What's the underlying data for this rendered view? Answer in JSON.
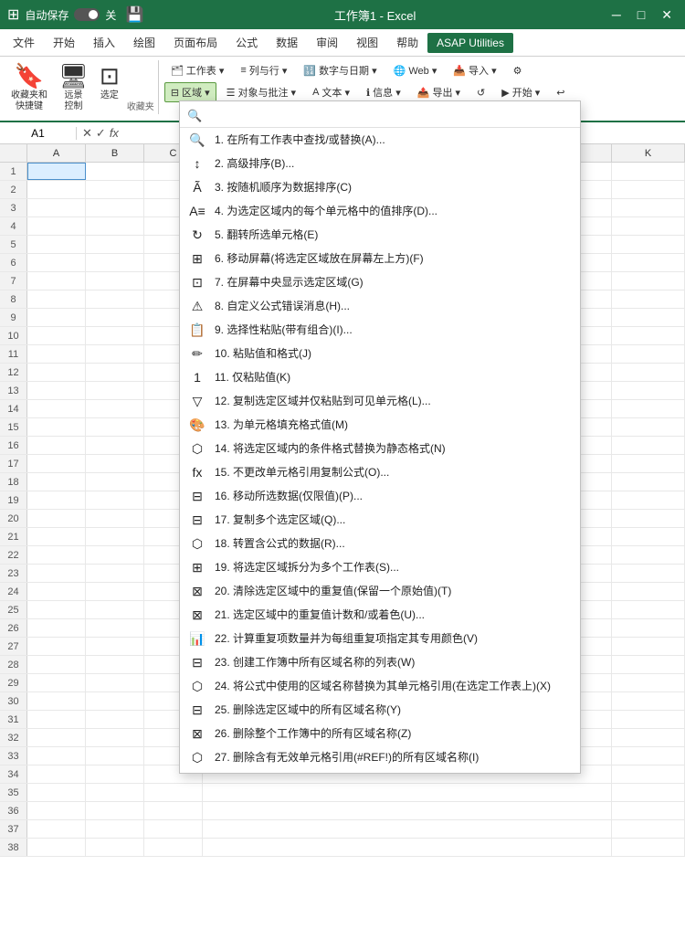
{
  "titleBar": {
    "appIcon": "⊞",
    "autosave_label": "自动保存",
    "toggle_state": "关",
    "save_icon": "💾",
    "filename": "工作簿1 - Excel",
    "min_btn": "─",
    "max_btn": "□",
    "close_btn": "✕"
  },
  "menuBar": {
    "items": [
      {
        "label": "文件",
        "id": "file"
      },
      {
        "label": "开始",
        "id": "home"
      },
      {
        "label": "插入",
        "id": "insert"
      },
      {
        "label": "绘图",
        "id": "draw"
      },
      {
        "label": "页面布局",
        "id": "pagelayout"
      },
      {
        "label": "公式",
        "id": "formulas"
      },
      {
        "label": "数据",
        "id": "data"
      },
      {
        "label": "审阅",
        "id": "review"
      },
      {
        "label": "视图",
        "id": "view"
      },
      {
        "label": "帮助",
        "id": "help"
      },
      {
        "label": "ASAP Utilities",
        "id": "asap",
        "active": true
      }
    ]
  },
  "ribbon": {
    "groups": [
      {
        "id": "favorites",
        "label": "收藏夹",
        "buttons": [
          {
            "label": "收藏夹和\n快捷键",
            "icon": "🔖",
            "size": "large"
          },
          {
            "label": "远景\n控制",
            "icon": "🖥",
            "size": "large"
          },
          {
            "label": "选定",
            "icon": "⊡",
            "size": "large"
          }
        ]
      }
    ],
    "smallGroups": [
      {
        "label": "🗂 工作表 ▾",
        "active": false
      },
      {
        "label": "≡ 列与行 ▾",
        "active": false
      },
      {
        "label": "🔢 数字与日期 ▾",
        "active": false
      },
      {
        "label": "🌐 Web ▾",
        "active": false
      },
      {
        "label": "📥 导入 ▾",
        "active": false
      },
      {
        "label": "⚙ 设置",
        "active": false
      },
      {
        "label": "区域 ▾",
        "active": true
      },
      {
        "label": "☰ 对象与批注 ▾",
        "active": false
      },
      {
        "label": "A 文本 ▾",
        "active": false
      },
      {
        "label": "ℹ 信息 ▾",
        "active": false
      },
      {
        "label": "📤 导出 ▾",
        "active": false
      },
      {
        "label": "↺",
        "active": false
      },
      {
        "label": "▶ 开始 ▾",
        "active": false
      },
      {
        "label": "↩",
        "active": false
      }
    ]
  },
  "formulaBar": {
    "cellRef": "A1",
    "checkBtn": "✓",
    "crossBtn": "✕",
    "fxBtn": "fx",
    "formula": ""
  },
  "columnHeaders": [
    "A",
    "B",
    "C",
    "",
    "K"
  ],
  "rows": [
    1,
    2,
    3,
    4,
    5,
    6,
    7,
    8,
    9,
    10,
    11,
    12,
    13,
    14,
    15,
    16,
    17,
    18,
    19,
    20,
    21,
    22,
    23,
    24,
    25,
    26,
    27,
    28,
    29,
    30,
    31,
    32,
    33,
    34,
    35,
    36,
    37,
    38
  ],
  "dropdown": {
    "searchPlaceholder": "",
    "items": [
      {
        "num": "1.",
        "text": "在所有工作表中查找/或替换(A)...",
        "icon": "🔍",
        "shortcut": "A"
      },
      {
        "num": "2.",
        "text": "高级排序(B)...",
        "icon": "↕",
        "shortcut": "B"
      },
      {
        "num": "3.",
        "text": "按随机顺序为数据排序(C)",
        "icon": "Ã",
        "shortcut": "C"
      },
      {
        "num": "4.",
        "text": "为选定区域内的每个单元格中的值排序(D)...",
        "icon": "A≡",
        "shortcut": "D"
      },
      {
        "num": "5.",
        "text": "翻转所选单元格(E)",
        "icon": "↻",
        "shortcut": "E"
      },
      {
        "num": "6.",
        "text": "移动屏幕(将选定区域放在屏幕左上方)(F)",
        "icon": "⊞",
        "shortcut": "F"
      },
      {
        "num": "7.",
        "text": "在屏幕中央显示选定区域(G)",
        "icon": "⊡",
        "shortcut": "G"
      },
      {
        "num": "8.",
        "text": "自定义公式错误消息(H)...",
        "icon": "⚠",
        "shortcut": "H"
      },
      {
        "num": "9.",
        "text": "选择性粘贴(带有组合)(I)...",
        "icon": "📋",
        "shortcut": "I"
      },
      {
        "num": "10.",
        "text": "粘贴值和格式(J)",
        "icon": "✏",
        "shortcut": "J"
      },
      {
        "num": "11.",
        "text": "仅粘贴值(K)",
        "icon": "1",
        "shortcut": "K"
      },
      {
        "num": "12.",
        "text": "复制选定区域并仅粘贴到可见单元格(L)...",
        "icon": "▽",
        "shortcut": "L"
      },
      {
        "num": "13.",
        "text": "为单元格填充格式值(M)",
        "icon": "🎨",
        "shortcut": "M"
      },
      {
        "num": "14.",
        "text": "将选定区域内的条件格式替换为静态格式(N)",
        "icon": "⬡",
        "shortcut": "N"
      },
      {
        "num": "15.",
        "text": "不更改单元格引用复制公式(O)...",
        "icon": "fx",
        "shortcut": "O"
      },
      {
        "num": "16.",
        "text": "移动所选数据(仅限值)(P)...",
        "icon": "⊟",
        "shortcut": "P"
      },
      {
        "num": "17.",
        "text": "复制多个选定区域(Q)...",
        "icon": "⊟",
        "shortcut": "Q"
      },
      {
        "num": "18.",
        "text": "转置含公式的数据(R)...",
        "icon": "⬡",
        "shortcut": "R"
      },
      {
        "num": "19.",
        "text": "将选定区域拆分为多个工作表(S)...",
        "icon": "⊞",
        "shortcut": "S"
      },
      {
        "num": "20.",
        "text": "清除选定区域中的重复值(保留一个原始值)(T)",
        "icon": "⊠",
        "shortcut": "T"
      },
      {
        "num": "21.",
        "text": "选定区域中的重复值计数和/或着色(U)...",
        "icon": "⊠",
        "shortcut": "U"
      },
      {
        "num": "22.",
        "text": "计算重复项数量并为每组重复项指定其专用颜色(V)",
        "icon": "📊",
        "shortcut": "V"
      },
      {
        "num": "23.",
        "text": "创建工作簿中所有区域名称的列表(W)",
        "icon": "⊟",
        "shortcut": "W"
      },
      {
        "num": "24.",
        "text": "将公式中使用的区域名称替换为其单元格引用(在选定工作表上)(X)",
        "icon": "⬡",
        "shortcut": "X"
      },
      {
        "num": "25.",
        "text": "删除选定区域中的所有区域名称(Y)",
        "icon": "⊟",
        "shortcut": "Y"
      },
      {
        "num": "26.",
        "text": "删除整个工作簿中的所有区域名称(Z)",
        "icon": "⊠",
        "shortcut": "Z"
      },
      {
        "num": "27.",
        "text": "删除含有无效单元格引用(#REF!)的所有区域名称(I)",
        "icon": "⬡",
        "shortcut": "I"
      }
    ]
  }
}
